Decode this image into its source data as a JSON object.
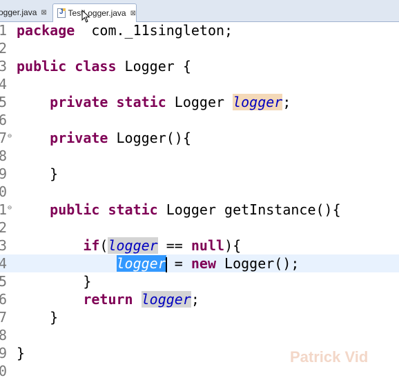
{
  "tabs": [
    {
      "label": "ogger.java",
      "active": false,
      "close": "⊠"
    },
    {
      "label": "TestLogger.java",
      "active": true,
      "close": "⊠"
    }
  ],
  "editor": {
    "lines": [
      {
        "num": "1",
        "fold": false,
        "parts": [
          [
            "kw",
            "package"
          ],
          [
            "",
            "  com._11singleton;"
          ]
        ]
      },
      {
        "num": "2",
        "fold": false,
        "parts": []
      },
      {
        "num": "3",
        "fold": false,
        "parts": [
          [
            "kw",
            "public"
          ],
          [
            "",
            " "
          ],
          [
            "kw",
            "class"
          ],
          [
            "",
            " Logger {"
          ]
        ]
      },
      {
        "num": "4",
        "fold": false,
        "parts": []
      },
      {
        "num": "5",
        "fold": false,
        "parts": [
          [
            "",
            "    "
          ],
          [
            "kw",
            "private"
          ],
          [
            "",
            " "
          ],
          [
            "kw",
            "static"
          ],
          [
            "",
            " Logger "
          ],
          [
            "fld occw",
            "logger"
          ],
          [
            "",
            ";"
          ]
        ]
      },
      {
        "num": "6",
        "fold": false,
        "parts": []
      },
      {
        "num": "7",
        "fold": true,
        "parts": [
          [
            "",
            "    "
          ],
          [
            "kw",
            "private"
          ],
          [
            "",
            " Logger(){"
          ]
        ]
      },
      {
        "num": "8",
        "fold": false,
        "parts": []
      },
      {
        "num": "9",
        "fold": false,
        "parts": [
          [
            "",
            "    }"
          ]
        ]
      },
      {
        "num": "0",
        "fold": false,
        "parts": []
      },
      {
        "num": "1",
        "fold": true,
        "parts": [
          [
            "",
            "    "
          ],
          [
            "kw",
            "public"
          ],
          [
            "",
            " "
          ],
          [
            "kw",
            "static"
          ],
          [
            "",
            " Logger getInstance(){"
          ]
        ]
      },
      {
        "num": "2",
        "fold": false,
        "parts": []
      },
      {
        "num": "3",
        "fold": false,
        "parts": [
          [
            "",
            "        "
          ],
          [
            "kw",
            "if"
          ],
          [
            "",
            "("
          ],
          [
            "fld occ",
            "logger"
          ],
          [
            "",
            " == "
          ],
          [
            "kw",
            "null"
          ],
          [
            "",
            "){"
          ]
        ]
      },
      {
        "num": "4",
        "fold": false,
        "current": true,
        "parts": [
          [
            "",
            "            "
          ],
          [
            "fld sel",
            "logger"
          ],
          [
            "caret",
            ""
          ],
          [
            "",
            " = "
          ],
          [
            "kw",
            "new"
          ],
          [
            "",
            " Logger();"
          ]
        ]
      },
      {
        "num": "5",
        "fold": false,
        "parts": [
          [
            "",
            "        }"
          ]
        ]
      },
      {
        "num": "6",
        "fold": false,
        "parts": [
          [
            "",
            "        "
          ],
          [
            "kw",
            "return"
          ],
          [
            "",
            " "
          ],
          [
            "fld occ",
            "logger"
          ],
          [
            "",
            ";"
          ]
        ]
      },
      {
        "num": "7",
        "fold": false,
        "parts": [
          [
            "",
            "    }"
          ]
        ]
      },
      {
        "num": "8",
        "fold": false,
        "parts": []
      },
      {
        "num": "9",
        "fold": false,
        "parts": [
          [
            "",
            "}"
          ]
        ]
      },
      {
        "num": "0",
        "fold": false,
        "parts": []
      }
    ]
  },
  "watermark": "Patrick Vid",
  "colors": {
    "keyword": "#7f0055",
    "field": "#0000c0",
    "selection": "#3399ff",
    "current_line": "#e8f2fe"
  }
}
